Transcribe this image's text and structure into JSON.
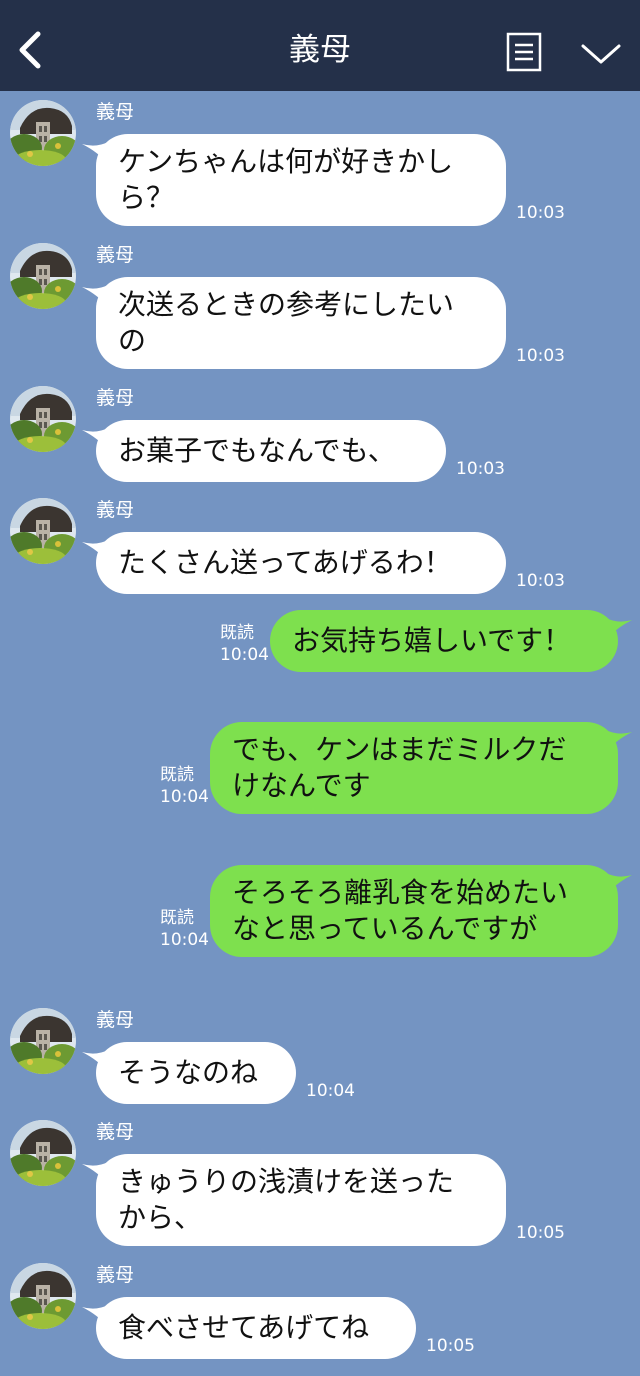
{
  "header": {
    "title": "義母"
  },
  "icons": {
    "back": "chevron-left-icon",
    "menu": "document-list-icon",
    "collapse": "chevron-down-icon"
  },
  "colors": {
    "header_bg": "#243049",
    "chat_bg": "#7494c2",
    "incoming_bubble": "#ffffff",
    "outgoing_bubble": "#7ee04e"
  },
  "messages": [
    {
      "sender": "義母",
      "direction": "in",
      "text": "ケンちゃんは何が好きかし\nら？",
      "time": "10:03"
    },
    {
      "sender": "義母",
      "direction": "in",
      "text": "次送るときの参考にしたい\nの",
      "time": "10:03"
    },
    {
      "sender": "義母",
      "direction": "in",
      "text": "お菓子でもなんでも、",
      "time": "10:03"
    },
    {
      "sender": "義母",
      "direction": "in",
      "text": "たくさん送ってあげるわ！",
      "time": "10:03"
    },
    {
      "sender": "",
      "direction": "out",
      "text": "お気持ち嬉しいです！",
      "time": "10:04",
      "read": "既読"
    },
    {
      "sender": "",
      "direction": "out",
      "text": "でも、ケンはまだミルクだ\nけなんです",
      "time": "10:04",
      "read": "既読"
    },
    {
      "sender": "",
      "direction": "out",
      "text": "そろそろ離乳食を始めたい\nなと思っているんですが",
      "time": "10:04",
      "read": "既読"
    },
    {
      "sender": "義母",
      "direction": "in",
      "text": "そうなのね",
      "time": "10:04"
    },
    {
      "sender": "義母",
      "direction": "in",
      "text": "きゅうりの浅漬けを送った\nから、",
      "time": "10:05"
    },
    {
      "sender": "義母",
      "direction": "in",
      "text": "食べさせてあげてね",
      "time": "10:05"
    }
  ]
}
